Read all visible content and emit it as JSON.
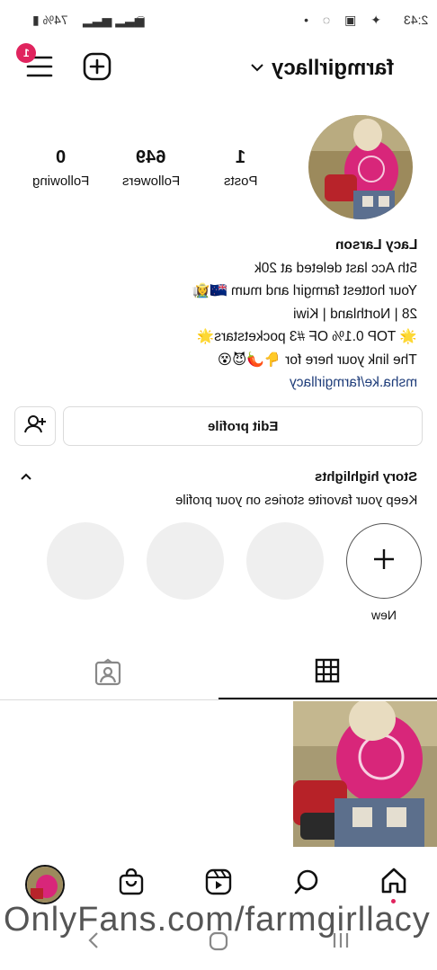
{
  "status_bar": {
    "time": "2:43",
    "battery": "74%"
  },
  "header": {
    "username": "farmgirllacy",
    "notification_count": "1"
  },
  "profile": {
    "posts": {
      "value": "1",
      "label": "Posts"
    },
    "followers": {
      "value": "649",
      "label": "Followers"
    },
    "following": {
      "value": "0",
      "label": "Following"
    }
  },
  "bio": {
    "name": "Lacy Larson",
    "line1": "5th Acc last deleted at 20k",
    "line2": "Your hottest farmgirl and mum 🇳🇿👩‍🌾",
    "line3": "28 | Northland | Kiwi",
    "line4": "🌟 TOP 0.1% OF #3 pocketstars🌟",
    "line5": "The link your here for 👇🌶️😈😵",
    "link": "msha.ke/farmgirllacy"
  },
  "actions": {
    "edit_profile": "Edit profile"
  },
  "highlights": {
    "title": "Story highlights",
    "subtitle": "Keep your favorite stories on your profile",
    "new_label": "New"
  },
  "watermark": "OnlyFans.com/farmgirllacy",
  "colors": {
    "badge": "#e0245e",
    "link": "#1f3d7a",
    "placeholder": "#efefef"
  }
}
